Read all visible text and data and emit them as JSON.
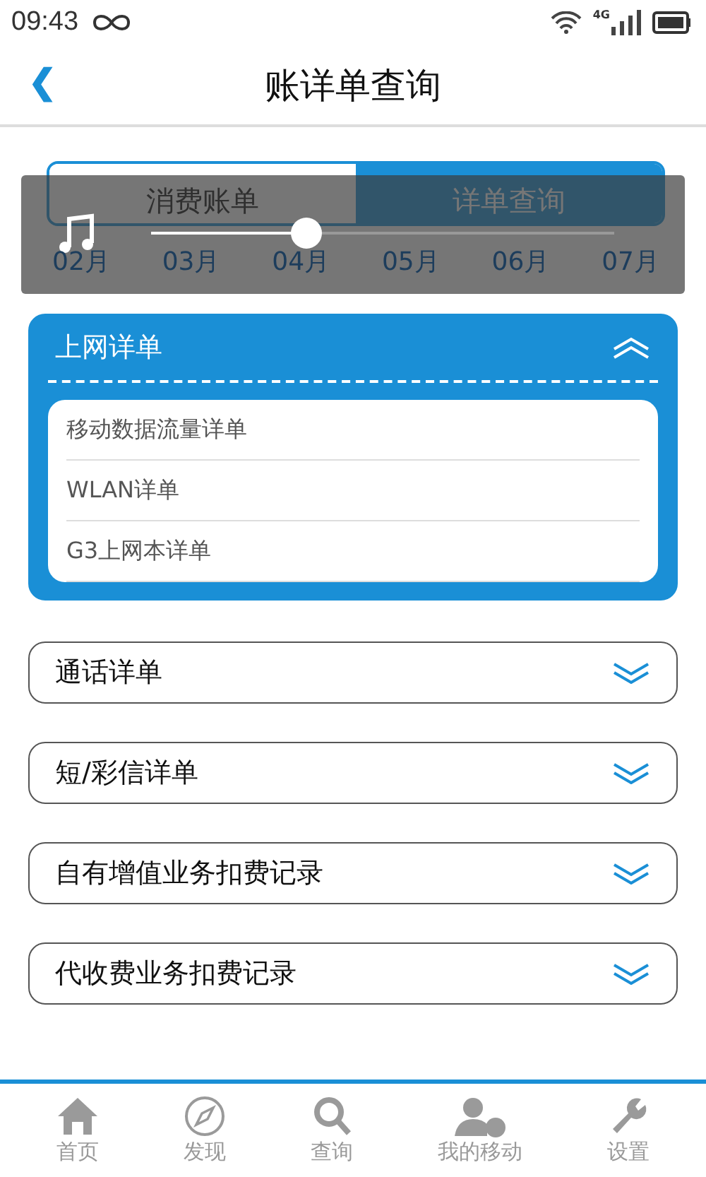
{
  "status_bar": {
    "time": "09:43",
    "network": "4G"
  },
  "header": {
    "back": "❮",
    "title": "账详单查询"
  },
  "tabs": [
    {
      "label": "消费账单",
      "selected": true
    },
    {
      "label": "详单查询",
      "selected": false
    }
  ],
  "player": {
    "level": 0.335,
    "months": [
      "02月",
      "03月",
      "04月",
      "05月",
      "06月",
      "07月"
    ]
  },
  "sections": [
    {
      "title": "上网详单",
      "expanded": true,
      "items": [
        "移动数据流量详单",
        "WLAN详单",
        "G3上网本详单"
      ]
    },
    {
      "title": "通话详单",
      "expanded": false
    },
    {
      "title": "短/彩信详单",
      "expanded": false
    },
    {
      "title": "自有增值业务扣费记录",
      "expanded": false
    },
    {
      "title": "代收费业务扣费记录",
      "expanded": false
    }
  ],
  "nav": [
    {
      "kind": "home",
      "label": "首页"
    },
    {
      "kind": "compass",
      "label": "发现"
    },
    {
      "kind": "search",
      "label": "查询"
    },
    {
      "kind": "user",
      "label": "我的移动"
    },
    {
      "kind": "wrench",
      "label": "设置"
    }
  ]
}
